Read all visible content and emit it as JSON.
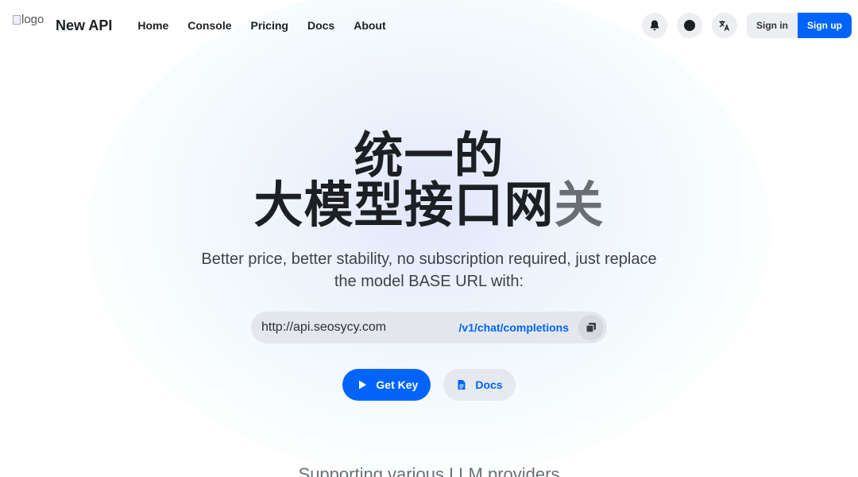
{
  "header": {
    "logo_alt": "logo",
    "brand": "New API",
    "nav": [
      "Home",
      "Console",
      "Pricing",
      "Docs",
      "About"
    ],
    "icons": [
      "bell-icon",
      "moon-icon",
      "translate-icon"
    ],
    "sign_in": "Sign in",
    "sign_up": "Sign up"
  },
  "hero": {
    "title_line1": "统一的",
    "title_line2_main": "大模型接口网",
    "title_line2_fade": "关",
    "subtitle": "Better price, better stability, no subscription required, just replace the model BASE URL with:",
    "base_url": "http://api.seosycy.com",
    "endpoint": "/v1/chat/completions",
    "get_key": "Get Key",
    "docs": "Docs"
  },
  "providers_heading": "Supporting various LLM providers",
  "colors": {
    "accent": "#0064fa",
    "text": "#1c1f23",
    "muted": "#6b6f75"
  }
}
